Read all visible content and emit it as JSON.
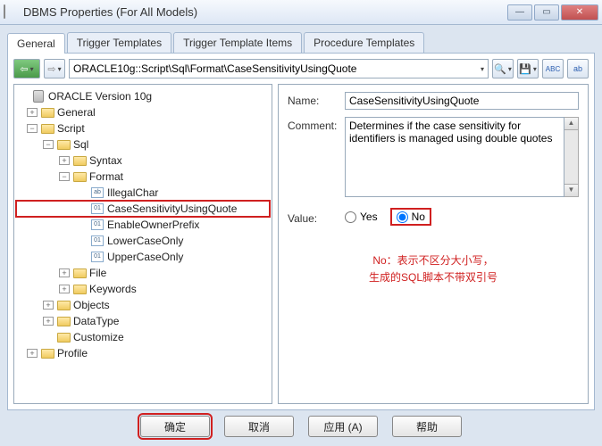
{
  "window": {
    "title": "DBMS Properties (For All Models)"
  },
  "tabs": [
    "General",
    "Trigger Templates",
    "Trigger Template Items",
    "Procedure Templates"
  ],
  "path": "ORACLE10g::Script\\Sql\\Format\\CaseSensitivityUsingQuote",
  "tree": {
    "root": "ORACLE Version 10g",
    "general": "General",
    "script": "Script",
    "sql": "Sql",
    "syntax": "Syntax",
    "format": "Format",
    "illegalchar": "IllegalChar",
    "casesens": "CaseSensitivityUsingQuote",
    "enableowner": "EnableOwnerPrefix",
    "lowercase": "LowerCaseOnly",
    "uppercase": "UpperCaseOnly",
    "file": "File",
    "keywords": "Keywords",
    "objects": "Objects",
    "datatype": "DataType",
    "customize": "Customize",
    "profile": "Profile"
  },
  "form": {
    "name_label": "Name:",
    "name_value": "CaseSensitivityUsingQuote",
    "comment_label": "Comment:",
    "comment_value": "Determines if the case sensitivity for identifiers is managed using double quotes",
    "value_label": "Value:",
    "yes": "Yes",
    "no": "No"
  },
  "annotation": {
    "line1": "No：表示不区分大小写，",
    "line2": "生成的SQL脚本不带双引号"
  },
  "buttons": {
    "ok": "确定",
    "cancel": "取消",
    "apply": "应用 (A)",
    "help": "帮助"
  },
  "toolbar_abc": "ABC",
  "toolbar_ab": "ab"
}
